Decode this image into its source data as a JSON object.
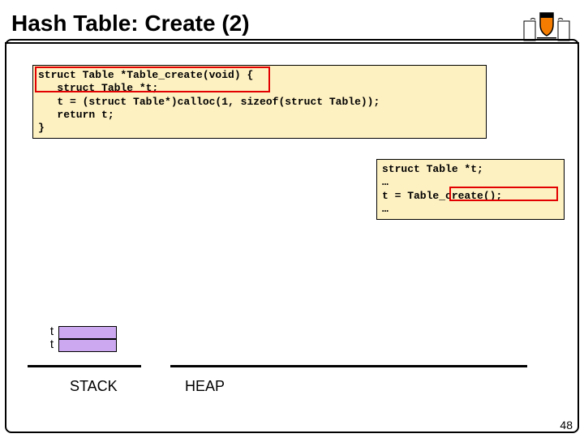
{
  "title": "Hash Table: Create (2)",
  "code_main": "struct Table *Table_create(void) {\n   struct Table *t;\n   t = (struct Table*)calloc(1, sizeof(struct Table));\n   return t;\n}",
  "code_client": "struct Table *t;\n…\nt = Table_create();\n…",
  "stack_labels": {
    "t1": "t",
    "t2": "t"
  },
  "regions": {
    "stack": "STACK",
    "heap": "HEAP"
  },
  "page_number": "48"
}
